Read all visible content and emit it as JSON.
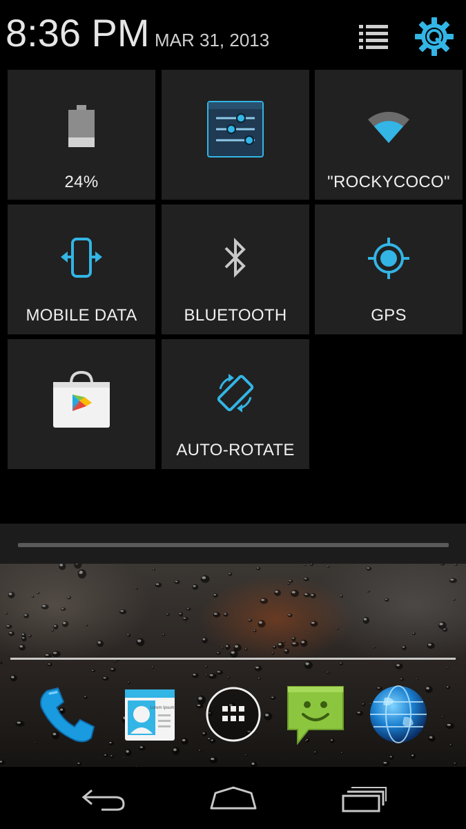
{
  "status_header": {
    "time": "8:36 PM",
    "date": "MAR 31, 2013",
    "list_icon": "list-icon",
    "settings_icon": "quick-settings-gear-icon"
  },
  "tiles": {
    "battery": {
      "label": "24%",
      "icon": "battery-icon"
    },
    "settings": {
      "label": "",
      "icon": "settings-sliders-icon"
    },
    "wifi": {
      "label": "\"ROCKYCOCO\"",
      "icon": "wifi-icon"
    },
    "mobile_data": {
      "label": "MOBILE DATA",
      "icon": "mobile-data-icon"
    },
    "bluetooth": {
      "label": "BLUETOOTH",
      "icon": "bluetooth-icon"
    },
    "gps": {
      "label": "GPS",
      "icon": "gps-icon"
    },
    "play_store": {
      "label": "",
      "icon": "play-store-icon"
    },
    "auto_rotate": {
      "label": "AUTO-ROTATE",
      "icon": "auto-rotate-icon"
    }
  },
  "dock": {
    "items": [
      {
        "name": "phone",
        "icon": "phone-icon"
      },
      {
        "name": "contacts",
        "icon": "contacts-icon",
        "card_text": "Lorem Ipsum"
      },
      {
        "name": "apps",
        "icon": "app-drawer-icon"
      },
      {
        "name": "messaging",
        "icon": "messaging-icon"
      },
      {
        "name": "browser",
        "icon": "browser-globe-icon"
      }
    ]
  },
  "navigation": {
    "back_icon": "back-icon",
    "home_icon": "home-icon",
    "recent_icon": "recent-apps-icon"
  },
  "colors": {
    "accent": "#33b5e5",
    "tile_background": "#212121",
    "background": "#000000"
  }
}
